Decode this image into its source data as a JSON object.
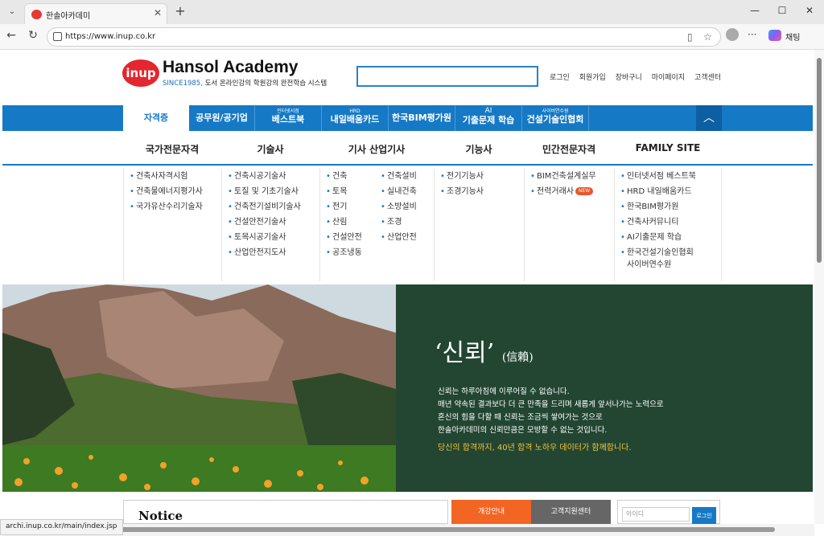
{
  "browser": {
    "tab_title": "한솔아카데미",
    "url": "https://www.inup.co.kr",
    "copilot_label": "채팅",
    "status_url": "archi.inup.co.kr/main/index.jsp"
  },
  "header": {
    "logo_text": "inup",
    "brand": "Hansol Academy",
    "tagline_accent": "SINCE1985,",
    "tagline_rest": " 도서 온라인강의 학원강의 완전학습 시스템",
    "links": [
      "로그인",
      "회원가입",
      "장바구니",
      "마이페이지",
      "고객센터"
    ]
  },
  "blue_nav": [
    {
      "small": "",
      "big": "자격증"
    },
    {
      "small": "",
      "big": "공무원/공기업"
    },
    {
      "small": "인터넷서점",
      "big": "베스트북"
    },
    {
      "small": "HRD",
      "big": "내일배움카드"
    },
    {
      "small": "",
      "big": "한국BIM평가원"
    },
    {
      "small": "AI",
      "big": "기출문제 학습"
    },
    {
      "small": "사이버연수원",
      "big": "건설기술인협회"
    }
  ],
  "categories": [
    "국가전문자격",
    "기술사",
    "기사 산업기사",
    "기능사",
    "민간전문자격",
    "FAMILY SITE"
  ],
  "columns": {
    "c1": [
      "건축사자격시험",
      "건축물에너지평가사",
      "국가유산수리기술자"
    ],
    "c2": [
      "건축시공기술사",
      "토질 및 기초기술사",
      "건축전기설비기술사",
      "건설안전기술사",
      "토목시공기술사",
      "산업안전지도사"
    ],
    "c3a": [
      "건축",
      "토목",
      "전기",
      "산림",
      "건설안전",
      "공조냉동"
    ],
    "c3b": [
      "건축설비",
      "실내건축",
      "소방설비",
      "조경",
      "산업안전"
    ],
    "c4": [
      "전기기능사",
      "조경기능사"
    ],
    "c5": [
      "BIM건축설계실무",
      "전력거래사"
    ],
    "c5_badge": "NEW",
    "c6": [
      "인터넷서점 베스트북",
      "HRD 내일배움카드",
      "한국BIM평가원",
      "건축사커뮤니티",
      "AI기출문제 학습",
      "한국건설기술인협회",
      "사이버연수원"
    ]
  },
  "hero": {
    "title": "‘신뢰’",
    "title_hanja": "(信賴)",
    "body": [
      "신뢰는 하루아침에 이루어질 수 없습니다.",
      "매년 약속된 결과보다 더 큰 만족을 드리며 새롭게 앞서나가는 노력으로",
      "혼신의 힘을 다할 때 신뢰는 조금씩 쌓여가는 것으로",
      "한솔아카데미의 신뢰만큼은 모방할 수 없는 것입니다."
    ],
    "accent": "당신의 합격까지, 40년 합격 노하우 데이터가 함께합니다."
  },
  "bottom": {
    "notice": "Notice",
    "btn1": "개강안내",
    "btn2": "고객지원센터",
    "id_placeholder": "아이디",
    "login_btn": "로그인"
  },
  "colors": {
    "brand_blue": "#1679c5",
    "brand_red": "#e3262f",
    "hero_green": "#224632",
    "accent_orange": "#f26522"
  }
}
